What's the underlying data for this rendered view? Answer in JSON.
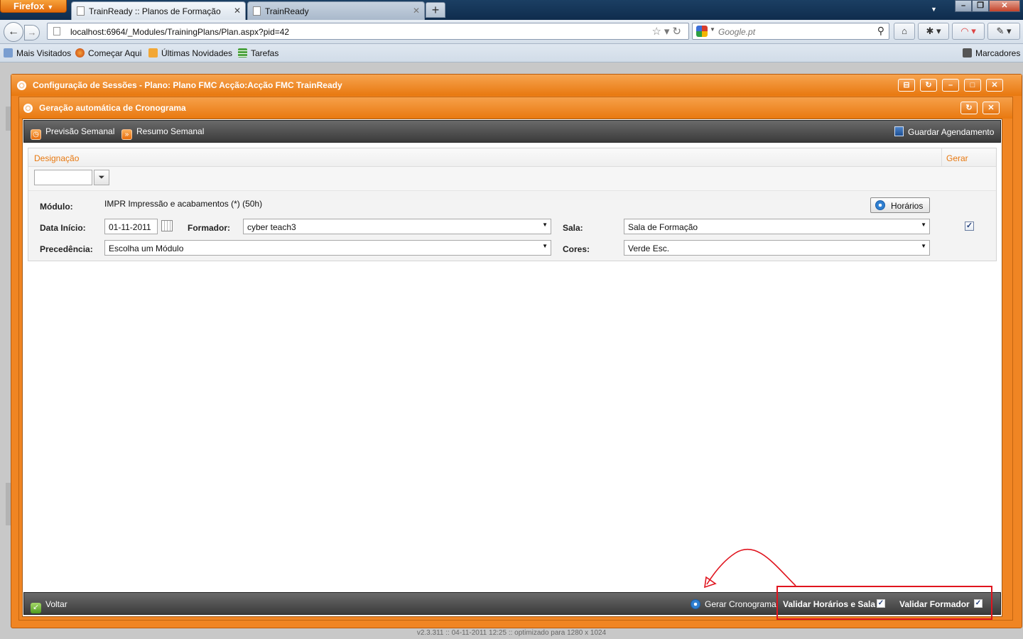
{
  "browser": {
    "menu_label": "Firefox",
    "tabs": [
      {
        "label": "TrainReady :: Planos de Formação",
        "active": true
      },
      {
        "label": "TrainReady",
        "active": false
      }
    ],
    "url": "localhost:6964/_Modules/TrainingPlans/Plan.aspx?pid=42",
    "search_placeholder": "Google.pt",
    "bookmarks": [
      "Mais Visitados",
      "Começar Aqui",
      "Últimas Novidades",
      "Tarefas"
    ],
    "bookmarks_menu": "Marcadores"
  },
  "outer_dialog": {
    "title": "Configuração de Sessões - Plano: Plano FMC Acção:Acção FMC TrainReady"
  },
  "inner_dialog": {
    "title": "Geração automática de Cronograma",
    "toolbar": {
      "weekly_preview": "Previsão Semanal",
      "weekly_summary": "Resumo Semanal",
      "save_schedule": "Guardar Agendamento"
    },
    "grid": {
      "columns": [
        "Designação",
        "Gerar"
      ],
      "filter_value": "",
      "row": {
        "module_label": "Módulo:",
        "module_value": "IMPR Impressão e acabamentos (*) (50h)",
        "schedules_button": "Horários",
        "start_date_label": "Data Início:",
        "start_date_value": "01-11-2011",
        "trainer_label": "Formador:",
        "trainer_value": "cyber teach3",
        "room_label": "Sala:",
        "room_value": "Sala de Formação",
        "precedence_label": "Precedência:",
        "precedence_value": "Escolha um Módulo",
        "colors_label": "Cores:",
        "colors_value": "Verde Esc.",
        "generate_checked": true
      }
    },
    "bottombar": {
      "back": "Voltar",
      "generate": "Gerar Cronograma",
      "validate_schedules_room": "Validar Horários e Sala",
      "validate_schedules_room_checked": true,
      "validate_trainer": "Validar Formador",
      "validate_trainer_checked": true
    }
  },
  "footer": "v2.3.311 :: 04-11-2011 12:25 :: optimizado para 1280 x 1024",
  "colors": {
    "accent_orange": "#f08523",
    "toolbar_dark": "#3b3b3b",
    "annotation_red": "#e0141e"
  }
}
